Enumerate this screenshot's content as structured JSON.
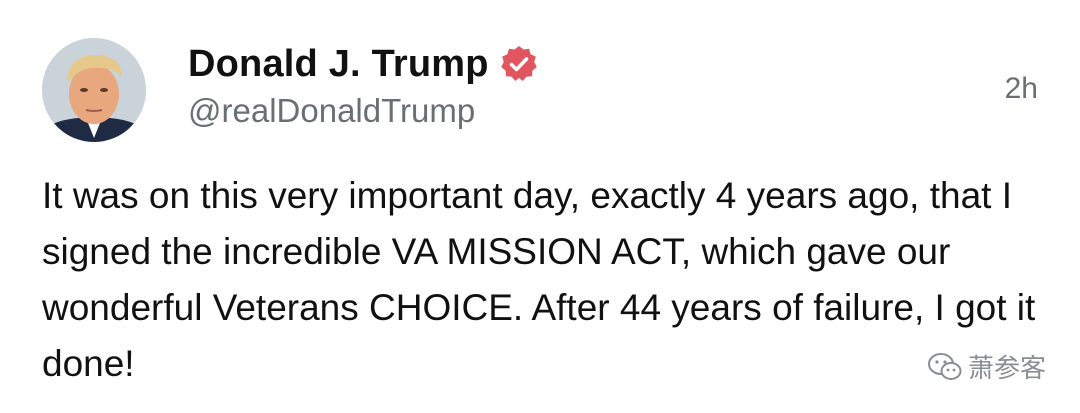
{
  "post": {
    "author": {
      "display_name": "Donald J. Trump",
      "handle": "@realDonaldTrump",
      "verified": true,
      "verified_color": "#e0555e"
    },
    "timestamp": "2h",
    "body_text": "It was on this very important day, exactly 4 years ago, that I signed the incredible VA MISSION ACT, which gave our wonderful Veterans CHOICE. After 44 years of failure, I got it done!"
  },
  "watermark": {
    "icon": "wechat-icon",
    "text": "萧参客"
  }
}
